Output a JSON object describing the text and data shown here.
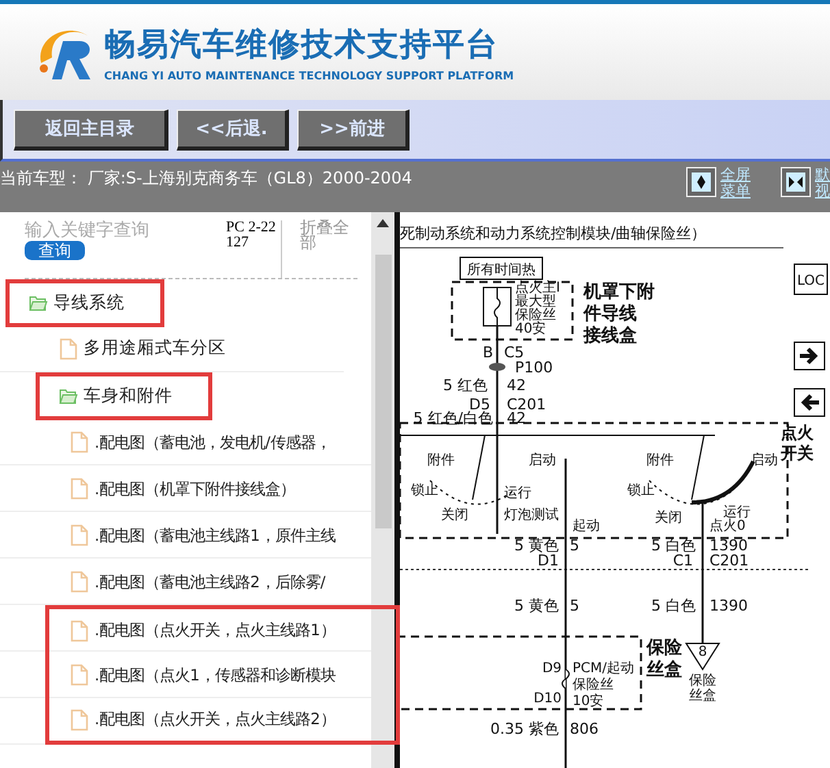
{
  "header": {
    "title": "畅易汽车维修技术支持平台",
    "subtitle": "CHANG YI AUTO MAINTENANCE TECHNOLOGY SUPPORT PLATFORM"
  },
  "toolbar": {
    "buttons": [
      "返回主目录",
      "<<后退.",
      ">>前进"
    ]
  },
  "vehicle_bar": {
    "text": "当前车型：  厂家:S-上海别克商务车（GL8）2000-2004",
    "links": [
      {
        "lines": [
          "全屏",
          "菜单"
        ]
      },
      {
        "lines": [
          "默",
          "视"
        ]
      }
    ]
  },
  "search": {
    "placeholder": "输入关键字查询",
    "button": "查询",
    "code": "PC 2-22127",
    "collapse": "折叠全部"
  },
  "tree": [
    {
      "label": "导线系统",
      "kind": "folder",
      "highlighted": true,
      "children": [
        {
          "label": "多用途厢式车分区",
          "kind": "file",
          "highlighted": false
        },
        {
          "label": "车身和附件",
          "kind": "folder",
          "highlighted": true,
          "children": [
            {
              "label": ".配电图（蓄电池，发电机/传感器，",
              "kind": "file",
              "highlighted": false
            },
            {
              "label": ".配电图（机罩下附件接线盒）",
              "kind": "file",
              "highlighted": false
            },
            {
              "label": ".配电图（蓄电池主线路1，原件主线",
              "kind": "file",
              "highlighted": false
            },
            {
              "label": ".配电图（蓄电池主线路2，后除雾/",
              "kind": "file",
              "highlighted": false
            },
            {
              "label": ".配电图（点火开关，点火主线路1）",
              "kind": "file",
              "highlighted": true
            },
            {
              "label": ".配电图（点火1，传感器和诊断模块",
              "kind": "file",
              "highlighted": true
            },
            {
              "label": ".配电图（点火开关，点火主线路2）",
              "kind": "file",
              "highlighted": true
            }
          ]
        }
      ]
    }
  ],
  "diagram": {
    "title": "死制动系统和动力系统控制模块/曲轴保险丝）",
    "labels": [
      "所有时间热",
      "点火主I",
      "最大型",
      "保险丝",
      "40安",
      "机罩下附",
      "件导线",
      "接线盒",
      "B",
      "C5",
      "P100",
      "5 红色",
      "42",
      "D5",
      "C201",
      "5 红色/白色",
      "42",
      "附件",
      "启动",
      "附件",
      "启动",
      "点火",
      "开关",
      "锁止",
      "关闭",
      "运行",
      "灯泡测试",
      "锁止",
      "关闭",
      "运行",
      "起动",
      "点火0",
      "5 黄色",
      "5",
      "D1",
      "5 白色",
      "1390",
      "C1",
      "C201",
      "5 黄色",
      "5",
      "5 白色",
      "1390",
      "D9",
      "PCM/起动",
      "保险丝",
      "D10",
      "10安",
      "保险",
      "丝盒",
      "8",
      "保险",
      "丝盒",
      "0.35 紫色",
      "806"
    ],
    "loc_label": "LOC"
  }
}
